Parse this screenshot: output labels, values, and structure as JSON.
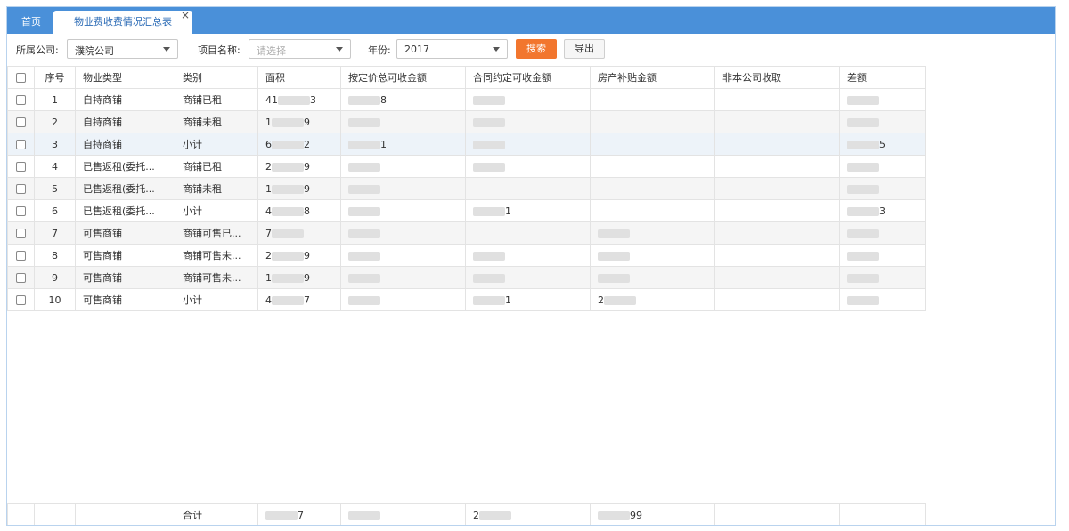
{
  "tabs": {
    "home": "首页",
    "active": "物业费收费情况汇总表",
    "close_glyph": "×"
  },
  "filters": {
    "company_label": "所属公司:",
    "company_value": "濮院公司",
    "project_label": "项目名称:",
    "project_placeholder": "请选择",
    "year_label": "年份:",
    "year_value": "2017",
    "search_button": "搜索",
    "export_button": "导出"
  },
  "table": {
    "headers": [
      "序号",
      "物业类型",
      "类别",
      "面积",
      "按定价总可收金额",
      "合同约定可收金额",
      "房产补贴金额",
      "非本公司收取",
      "差额"
    ],
    "rows": [
      {
        "no": "1",
        "type": "自持商铺",
        "category": "商铺已租",
        "area": "41",
        "area_tail": "3",
        "price_total": "8"
      },
      {
        "no": "2",
        "type": "自持商铺",
        "category": "商铺未租",
        "area": "1",
        "area_tail": "9",
        "price_total": ""
      },
      {
        "no": "3",
        "type": "自持商铺",
        "category": "小计",
        "area": "6",
        "area_tail": "2",
        "price_total": "1",
        "diff": "5"
      },
      {
        "no": "4",
        "type": "已售返租(委托...",
        "category": "商铺已租",
        "area": "2",
        "area_tail": "9"
      },
      {
        "no": "5",
        "type": "已售返租(委托...",
        "category": "商铺未租",
        "area": "1",
        "area_tail": "9"
      },
      {
        "no": "6",
        "type": "已售返租(委托...",
        "category": "小计",
        "area": "4",
        "area_tail": "8",
        "contract": "1",
        "diff": "3"
      },
      {
        "no": "7",
        "type": "可售商铺",
        "category": "商铺可售已...",
        "area": "7",
        "area_tail": ""
      },
      {
        "no": "8",
        "type": "可售商铺",
        "category": "商铺可售未...",
        "area": "2",
        "area_tail": "9"
      },
      {
        "no": "9",
        "type": "可售商铺",
        "category": "商铺可售未...",
        "area": "1",
        "area_tail": "9"
      },
      {
        "no": "10",
        "type": "可售商铺",
        "category": "小计",
        "area": "4",
        "area_tail": "7",
        "contract": "1",
        "subsidy": "2"
      }
    ],
    "footer": {
      "label": "合计",
      "area_tail": "7",
      "contract_head": "2",
      "subsidy_tail": "99"
    }
  }
}
